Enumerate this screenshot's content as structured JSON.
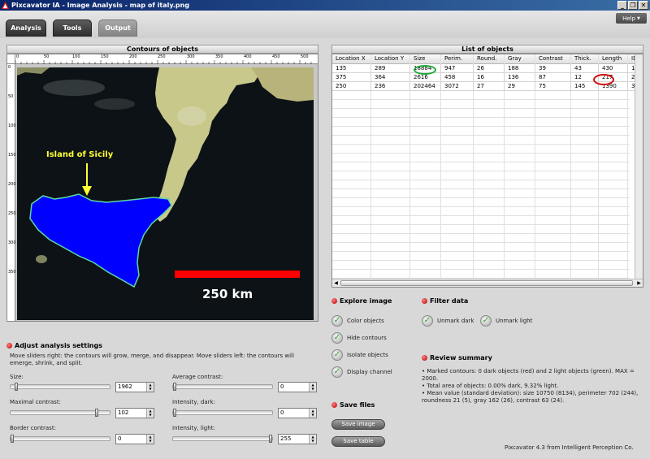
{
  "window": {
    "title": "Pixcavator IA - Image Analysis - map of italy.png",
    "controls": [
      "_",
      "❐",
      "✕"
    ]
  },
  "tabs": [
    {
      "label": "Analysis",
      "active": false
    },
    {
      "label": "Tools",
      "active": false
    },
    {
      "label": "Output",
      "active": true
    }
  ],
  "help": {
    "label": "Help",
    "arrow": "▼"
  },
  "image_panel": {
    "title": "Contours of objects",
    "ruler_x": [
      "0",
      "50",
      "100",
      "150",
      "200",
      "250",
      "300",
      "350",
      "400",
      "450",
      "500"
    ],
    "ruler_y": [
      "0",
      "50",
      "100",
      "150",
      "200",
      "250",
      "300",
      "350"
    ],
    "annotation_label": "Island of Sicily",
    "scale_label": "250 km",
    "colors": {
      "sea": "#0d1216",
      "land": "#c7c88a",
      "sicily": "#0000ff",
      "contour": "#5ad7a8",
      "scalebar": "#ff0000",
      "annotation": "#ffff33"
    }
  },
  "table_panel": {
    "title": "List of objects",
    "columns": [
      "Location X",
      "Location Y",
      "Size",
      "Perim.",
      "Round.",
      "Gray",
      "Contrast",
      "Thick.",
      "Length",
      "ID"
    ],
    "rows": [
      [
        "135",
        "289",
        "18884",
        "947",
        "26",
        "188",
        "39",
        "43",
        "430",
        "1"
      ],
      [
        "375",
        "364",
        "2616",
        "458",
        "16",
        "136",
        "87",
        "12",
        "217",
        "2"
      ],
      [
        "250",
        "236",
        "202464",
        "3072",
        "27",
        "29",
        "75",
        "145",
        "1390",
        "3"
      ]
    ],
    "highlight_colors": {
      "size": "#1aa83a",
      "length": "#d01010"
    }
  },
  "settings": {
    "title": "Adjust analysis settings",
    "description": "Move sliders right: the contours will grow, merge, and disappear. Move sliders left: the contours will emerge, shrink, and split.",
    "sliders": [
      {
        "label": "Size:",
        "value": "1962",
        "level": 0.05
      },
      {
        "label": "Average contrast:",
        "value": "0",
        "level": 0.0
      },
      {
        "label": "Maximal contrast:",
        "value": "102",
        "level": 0.85
      },
      {
        "label": "Intensity, dark:",
        "value": "0",
        "level": 0.0
      },
      {
        "label": "Border contrast:",
        "value": "0",
        "level": 0.0
      },
      {
        "label": "Intensity, light:",
        "value": "255",
        "level": 1.0
      }
    ]
  },
  "explore": {
    "title": "Explore image",
    "items": [
      "Color objects",
      "Hide contours",
      "Isolate objects",
      "Display channel"
    ]
  },
  "filter": {
    "title": "Filter data",
    "items": [
      "Unmark dark",
      "Unmark light"
    ]
  },
  "review": {
    "title": "Review summary",
    "lines": [
      "• Marked contours: 0 dark objects (red) and 2 light objects (green). MAX = 2000.",
      "• Total area of objects: 0.00% dark, 9.32% light.",
      "• Mean value (standard deviation): size 10750 (8134), perimeter 702 (244),",
      "roundness 21 (5), gray 162 (26), contrast 63 (24)."
    ]
  },
  "save": {
    "title": "Save files",
    "buttons": [
      "Save image",
      "Save table"
    ]
  },
  "footer": "Pixcavator 4.3 from Intelligent Perception Co."
}
